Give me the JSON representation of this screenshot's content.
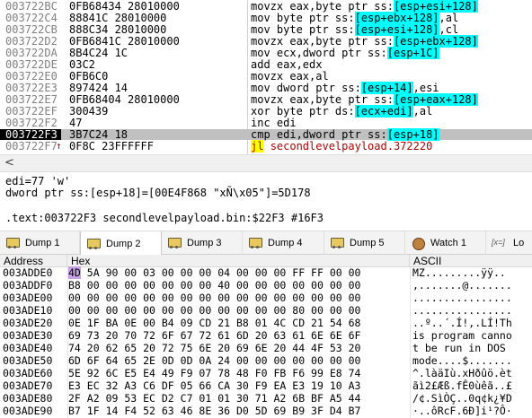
{
  "disasm": {
    "rows": [
      {
        "addr": "003722BC",
        "bytes": "0FB68434 28010000",
        "mnem": "movzx eax,byte ptr ss:",
        "reg": "[esp+esi+128]",
        "tail": ""
      },
      {
        "addr": "003722C4",
        "bytes": "88841C 28010000",
        "mnem": "mov byte ptr ss:",
        "reg": "[esp+ebx+128]",
        "tail": ",al"
      },
      {
        "addr": "003722CB",
        "bytes": "888C34 28010000",
        "mnem": "mov byte ptr ss:",
        "reg": "[esp+esi+128]",
        "tail": ",cl"
      },
      {
        "addr": "003722D2",
        "bytes": "0FB6841C 28010000",
        "mnem": "movzx eax,byte ptr ss:",
        "reg": "[esp+ebx+128]",
        "tail": ""
      },
      {
        "addr": "003722DA",
        "bytes": "8B4C24 1C",
        "mnem": "mov ecx,dword ptr ss:",
        "reg": "[esp+1C]",
        "tail": ""
      },
      {
        "addr": "003722DE",
        "bytes": "03C2",
        "mnem": "add eax,edx",
        "reg": "",
        "tail": ""
      },
      {
        "addr": "003722E0",
        "bytes": "0FB6C0",
        "mnem": "movzx eax,al",
        "reg": "",
        "tail": ""
      },
      {
        "addr": "003722E3",
        "bytes": "897424 14",
        "mnem": "mov dword ptr ss:",
        "reg": "[esp+14]",
        "tail": ",esi"
      },
      {
        "addr": "003722E7",
        "bytes": "0FB68404 28010000",
        "mnem": "movzx eax,byte ptr ss:",
        "reg": "[esp+eax+128]",
        "tail": ""
      },
      {
        "addr": "003722EF",
        "bytes": "300439",
        "mnem": "xor byte ptr ds:",
        "reg": "[ecx+edi]",
        "tail": ",al"
      },
      {
        "addr": "003722F2",
        "bytes": "47",
        "mnem": "inc edi",
        "reg": "",
        "tail": ""
      },
      {
        "addr": "003722F3",
        "bytes": "3B7C24 18",
        "mnem": "cmp edi,dword ptr ss:",
        "reg": "[esp+18]",
        "tail": ""
      },
      {
        "addr": "003722F7",
        "bytes": "0F8C 23FFFFFF",
        "mnem": "jl",
        "reg": "",
        "tail": "secondlevelpayload.372220"
      }
    ],
    "selected_index": 11,
    "jump_index": 12
  },
  "info": {
    "line1": "edi=77 'w'",
    "line2": "dword ptr ss:[esp+18]=[00E4F868 \"xÑ\\x05\"]=5D178",
    "line3": ".text:003722F3 secondlevelpayload.bin:$22F3 #16F3"
  },
  "tabs": [
    {
      "label": "Dump 1",
      "icon": "dump-icon",
      "active": false
    },
    {
      "label": "Dump 2",
      "icon": "dump-icon",
      "active": true
    },
    {
      "label": "Dump 3",
      "icon": "dump-icon",
      "active": false
    },
    {
      "label": "Dump 4",
      "icon": "dump-icon",
      "active": false
    },
    {
      "label": "Dump 5",
      "icon": "dump-icon",
      "active": false
    },
    {
      "label": "Watch 1",
      "icon": "watch-icon",
      "active": false
    },
    {
      "label": "Lo",
      "icon": "locals-icon",
      "active": false
    }
  ],
  "dump": {
    "headers": {
      "address": "Address",
      "hex": "Hex",
      "ascii": "ASCII"
    },
    "rows": [
      {
        "addr": "003ADDE0",
        "b0": "4D",
        "hex": "5A 90 00 03 00 00 00 04 00 00 00 FF FF 00 00",
        "ascii": "MZ.........ÿÿ.."
      },
      {
        "addr": "003ADDF0",
        "b0": "B8",
        "hex": "00 00 00 00 00 00 00 40 00 00 00 00 00 00 00",
        "ascii": ",.......@......."
      },
      {
        "addr": "003ADE00",
        "b0": "00",
        "hex": "00 00 00 00 00 00 00 00 00 00 00 00 00 00 00",
        "ascii": "................"
      },
      {
        "addr": "003ADE10",
        "b0": "00",
        "hex": "00 00 00 00 00 00 00 00 00 00 00 80 00 00 00",
        "ascii": "................"
      },
      {
        "addr": "003ADE20",
        "b0": "0E",
        "hex": "1F BA 0E 00 B4 09 CD 21 B8 01 4C CD 21 54 68",
        "ascii": "..º..´.Í!,.LÍ!Th"
      },
      {
        "addr": "003ADE30",
        "b0": "69",
        "hex": "73 20 70 72 6F 67 72 61 6D 20 63 61 6E 6E 6F",
        "ascii": "is program canno"
      },
      {
        "addr": "003ADE40",
        "b0": "74",
        "hex": "20 62 65 20 72 75 6E 20 69 6E 20 44 4F 53 20",
        "ascii": "t be run in DOS "
      },
      {
        "addr": "003ADE50",
        "b0": "6D",
        "hex": "6F 64 65 2E 0D 0D 0A 24 00 00 00 00 00 00 00",
        "ascii": "mode....$......."
      },
      {
        "addr": "003ADE60",
        "b0": "5E",
        "hex": "92 6C E5 E4 49 F9 07 78 48 F0 FB F6 99 E8 74",
        "ascii": "^.làäIù.xHðûö.èt"
      },
      {
        "addr": "003ADE70",
        "b0": "E3",
        "hex": "EC 32 A3 C6 DF 05 66 CA 30 F9 EA E3 19 10 A3",
        "ascii": "ãì2£Æß.fÊ0ùêã..£"
      },
      {
        "addr": "003ADE80",
        "b0": "2F",
        "hex": "A2 09 53 EC D2 C7 01 01 30 71 A2 6B BF A5 44",
        "ascii": "/¢.SìÒÇ..0q¢k¿¥D"
      },
      {
        "addr": "003ADE90",
        "b0": "B7",
        "hex": "1F 14 F4 52 63 46 8E 36 D0 5D 69 B9 3F D4 B7",
        "ascii": "·..ôRcF.6Ð]i¹?Ô·"
      }
    ]
  },
  "colors": {
    "selection": "#c0c0c0",
    "register_highlight": "#00ffff",
    "jump_highlight": "#ffff00",
    "byte_highlight": "#c8a0e8"
  }
}
